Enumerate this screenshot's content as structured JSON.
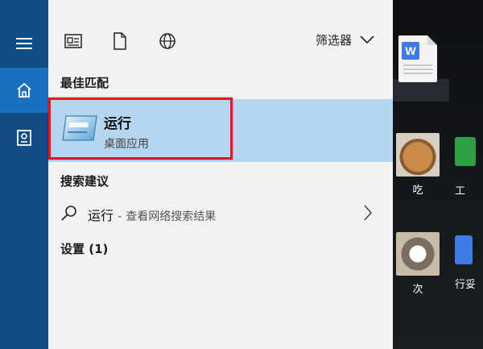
{
  "toolbar": {
    "icons": [
      "documents-icon",
      "file-icon",
      "web-icon"
    ],
    "filter_label": "筛选器"
  },
  "rail": {
    "items": [
      {
        "name": "menu-icon",
        "active": false
      },
      {
        "name": "home-icon",
        "active": true
      },
      {
        "name": "library-icon",
        "active": false
      }
    ]
  },
  "best_match": {
    "heading": "最佳匹配",
    "title": "运行",
    "subtitle": "桌面应用"
  },
  "suggestions": {
    "heading": "搜索建议",
    "item": {
      "term": "运行",
      "separator": "-",
      "hint": "查看网络搜索结果"
    }
  },
  "settings": {
    "heading": "设置 (1)"
  },
  "desktop": {
    "icons": [
      {
        "name": "word-doc-icon",
        "label": ""
      },
      {
        "name": "photo-dog-icon",
        "label": "吃"
      },
      {
        "name": "green-app-icon",
        "label": "工"
      },
      {
        "name": "photo-husky-icon",
        "label": "次"
      },
      {
        "name": "blue-app-icon",
        "label": "行妥"
      }
    ]
  },
  "colors": {
    "rail": "#114c83",
    "rail_active": "#1a6fbf",
    "panel": "#f2f2f2",
    "best_match_bg": "#b6d6ef",
    "highlight_border": "#e0181f"
  }
}
